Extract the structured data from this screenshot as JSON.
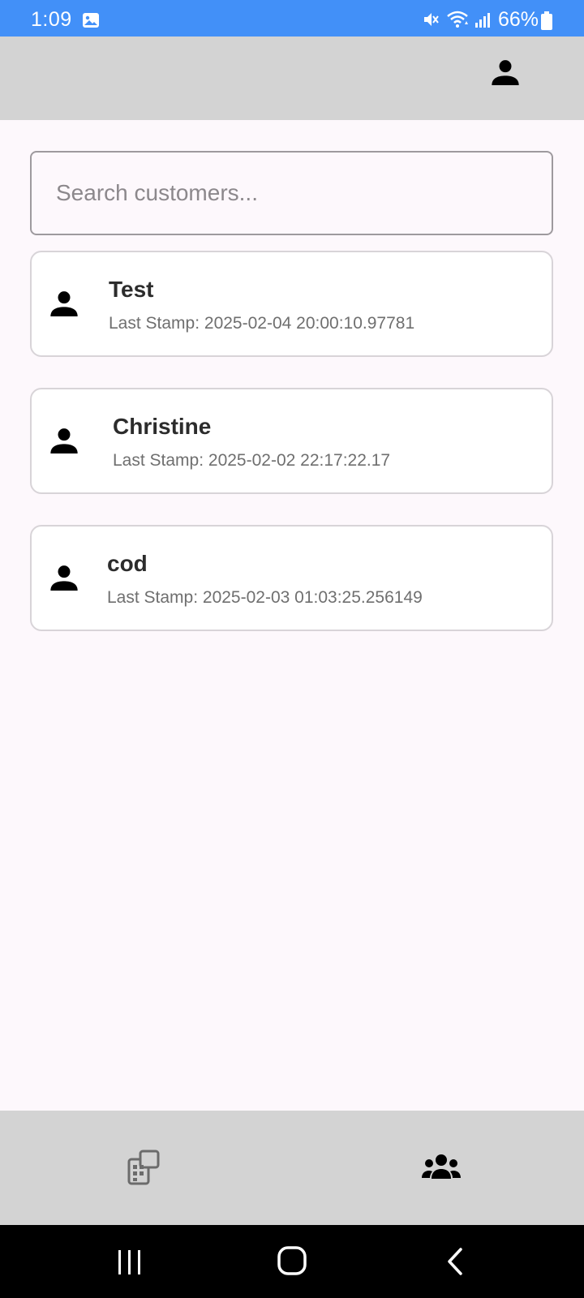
{
  "status_bar": {
    "time": "1:09",
    "battery": "66%",
    "background_color": "#4290f8",
    "icons": [
      "gallery-icon",
      "mute-icon",
      "wifi-icon",
      "signal-icon",
      "battery-icon"
    ]
  },
  "top_bar": {
    "background_color": "#d3d3d3",
    "profile_icon": "person-icon"
  },
  "search": {
    "placeholder": "Search customers...",
    "value": ""
  },
  "customers": [
    {
      "name": "Test",
      "last_stamp": "Last Stamp: 2025-02-04 20:00:10.97781",
      "icon": "person-icon"
    },
    {
      "name": "Christine",
      "last_stamp": "Last Stamp: 2025-02-02 22:17:22.17",
      "icon": "person-icon"
    },
    {
      "name": "cod",
      "last_stamp": "Last Stamp: 2025-02-03 01:03:25.256149",
      "icon": "person-icon"
    }
  ],
  "bottom_nav": {
    "items": [
      {
        "icon": "stamp-card-icon",
        "active": false
      },
      {
        "icon": "group-icon",
        "active": true
      }
    ],
    "background_color": "#d3d3d3"
  },
  "system_nav": {
    "icons": [
      "recents-icon",
      "home-icon",
      "back-icon"
    ]
  }
}
